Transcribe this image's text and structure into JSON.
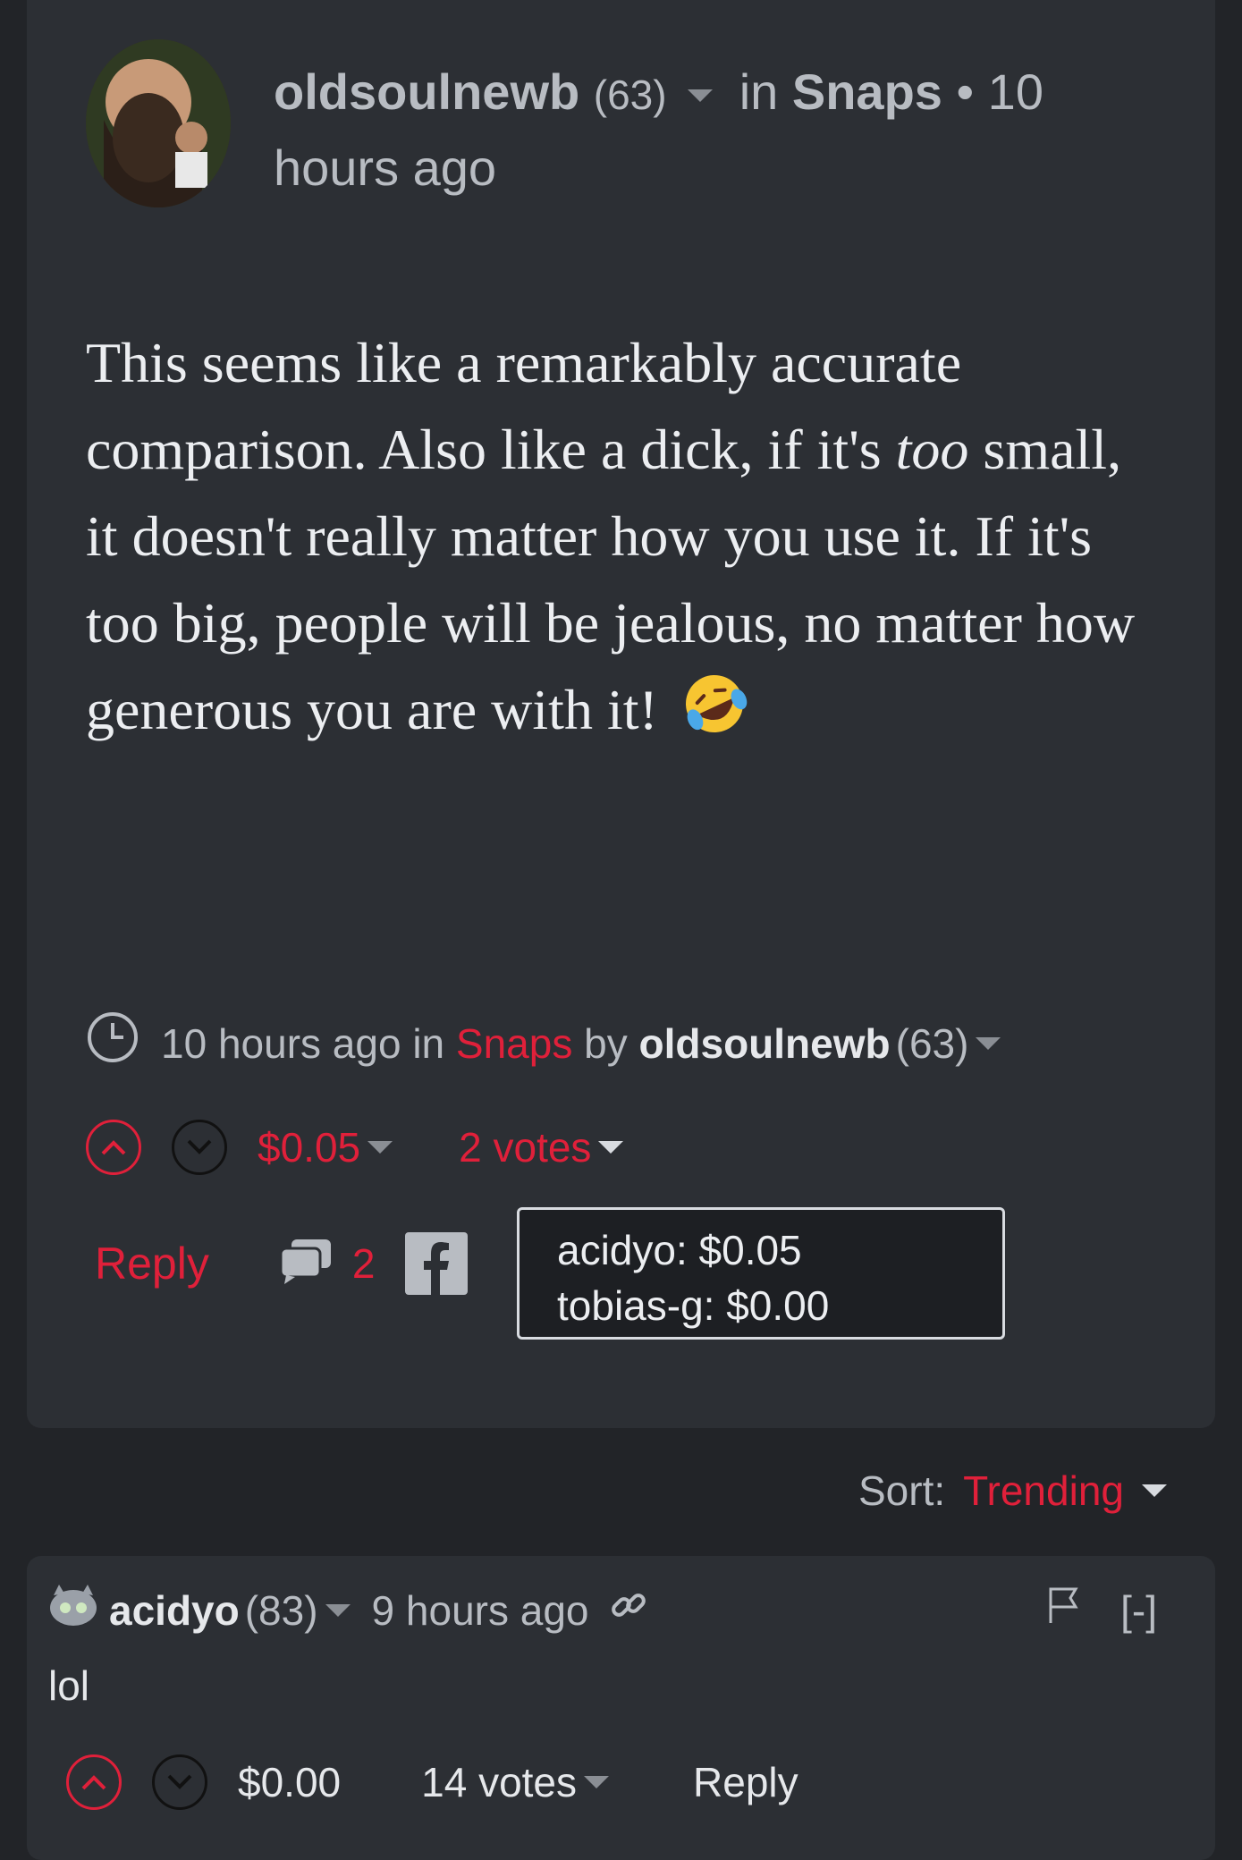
{
  "post": {
    "author": "oldsoulnewb",
    "author_rep": "(63)",
    "in_text": "in",
    "category": "Snaps",
    "bullet": "•",
    "time_ago": "10 hours ago",
    "body_part1": "This seems like a remarkably accurate comparison. Also like a dick, if it's ",
    "body_emphasis": "too",
    "body_part2": " small, it doesn't really matter how you use it. If it's too big, people will be jealous, no matter how generous you are with it!",
    "emoji": "rolling-on-floor-laughing"
  },
  "footer": {
    "time_ago": "10 hours ago",
    "in_text": "in",
    "category": "Snaps",
    "by_text": "by",
    "author": "oldsoulnewb",
    "author_rep": "(63)",
    "payout": "$0.05",
    "votes": "2 votes",
    "reply_label": "Reply",
    "comment_count": "2",
    "icons": [
      "clock-icon",
      "upvote-icon",
      "downvote-icon",
      "comments-icon",
      "facebook-icon"
    ]
  },
  "voters_tooltip": {
    "line1": "acidyo: $0.05",
    "line2": "tobias-g: $0.00"
  },
  "sort": {
    "label": "Sort:",
    "value": "Trending"
  },
  "comment": {
    "author": "acidyo",
    "author_rep": "(83)",
    "time_ago": "9 hours ago",
    "collapse": "[-]",
    "body": "lol",
    "payout": "$0.00",
    "votes": "14 votes",
    "reply_label": "Reply"
  },
  "colors": {
    "accent": "#e0203a",
    "background": "#222428",
    "card": "#2c2f34"
  }
}
